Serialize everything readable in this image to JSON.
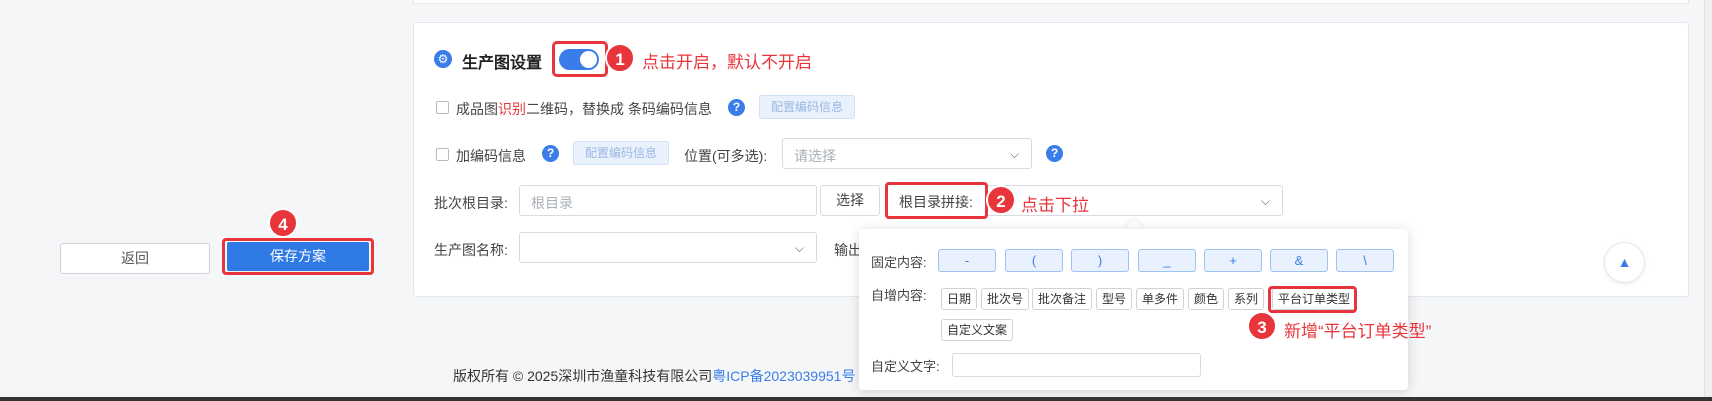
{
  "production_settings": {
    "icon": "gear-icon",
    "title": "生产图设置",
    "toggle_on": true
  },
  "annotations": {
    "a1": {
      "num": "1",
      "text": "点击开启，默认不开启"
    },
    "a2": {
      "num": "2",
      "text": "点击下拉"
    },
    "a3": {
      "num": "3",
      "text": "新增“平台订单类型”"
    },
    "a4": {
      "num": "4"
    }
  },
  "row1": {
    "label_prefix": "成品图",
    "label_highlight": "识别",
    "label_suffix": "二维码，替换成 条码编码信息",
    "help": "?",
    "config_button": "配置编码信息"
  },
  "row2": {
    "label": "加编码信息",
    "help": "?",
    "config_button": "配置编码信息",
    "position_label": "位置(可多选):",
    "position_placeholder": "请选择",
    "help2": "?"
  },
  "row3": {
    "batch_root_label": "批次根目录:",
    "batch_root_placeholder": "根目录",
    "select_button": "选择",
    "root_join_label": "根目录拼接:"
  },
  "row4": {
    "name_label": "生产图名称:",
    "output_label": "输出"
  },
  "dropdown": {
    "fixed_label": "固定内容:",
    "fixed_items": [
      "-",
      "(",
      ")",
      "_",
      "+",
      "&",
      "\\"
    ],
    "auto_label": "自增内容:",
    "auto_items": [
      "日期",
      "批次号",
      "批次备注",
      "型号",
      "单多件",
      "颜色",
      "系列",
      "平台订单类型"
    ],
    "auto_items_row2": [
      "自定义文案"
    ],
    "custom_label": "自定义文字:"
  },
  "actions": {
    "back": "返回",
    "save": "保存方案"
  },
  "footer": {
    "copyright": "版权所有 © 2025深圳市渔童科技有限公司",
    "icp": "粤ICP备2023039951号"
  },
  "colors": {
    "primary": "#3b7de8",
    "annotation_red": "#e8353b"
  }
}
